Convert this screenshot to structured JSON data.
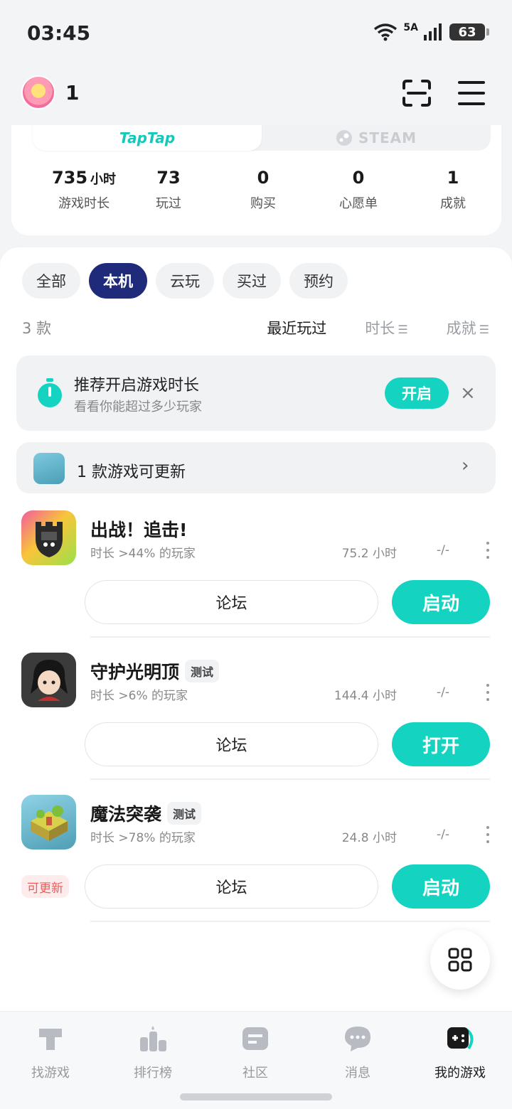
{
  "status_bar": {
    "time": "03:45",
    "network": "5A",
    "battery": "63"
  },
  "header": {
    "username": "1",
    "scan_icon": "scan-icon",
    "menu_icon": "menu-icon"
  },
  "platform_tabs": [
    {
      "label": "TapTap",
      "active": true
    },
    {
      "label": "STEAM",
      "active": false
    }
  ],
  "stats": [
    {
      "value": "735",
      "unit": "小时",
      "label": "游戏时长"
    },
    {
      "value": "73",
      "label": "玩过"
    },
    {
      "value": "0",
      "label": "购买"
    },
    {
      "value": "0",
      "label": "心愿单"
    },
    {
      "value": "1",
      "label": "成就"
    }
  ],
  "filters": [
    {
      "label": "全部",
      "active": false
    },
    {
      "label": "本机",
      "active": true
    },
    {
      "label": "云玩",
      "active": false
    },
    {
      "label": "买过",
      "active": false
    },
    {
      "label": "预约",
      "active": false
    }
  ],
  "list_header": {
    "count": "3 款",
    "sort_recent": "最近玩过",
    "sort_hours": "时长",
    "sort_achievements": "成就"
  },
  "recommend": {
    "title": "推荐开启游戏时长",
    "subtitle": "看看你能超过多少玩家",
    "button": "开启",
    "close": "×"
  },
  "update_banner": {
    "text": "1 款游戏可更新",
    "chevron": "›"
  },
  "games": [
    {
      "name": "出战！追击!",
      "tag": "",
      "subtitle": "时长 >44% 的玩家",
      "hours": "75.2 小时",
      "achievements": "-/-",
      "forum": "论坛",
      "action": "启动",
      "badge": ""
    },
    {
      "name": "守护光明顶",
      "tag": "测试",
      "subtitle": "时长 >6% 的玩家",
      "hours": "144.4 小时",
      "achievements": "-/-",
      "forum": "论坛",
      "action": "打开",
      "badge": ""
    },
    {
      "name": "魔法突袭",
      "tag": "测试",
      "subtitle": "时长 >78% 的玩家",
      "hours": "24.8 小时",
      "achievements": "-/-",
      "forum": "论坛",
      "action": "启动",
      "badge": "可更新"
    }
  ],
  "bottom_nav": [
    {
      "label": "找游戏",
      "icon": "find-games-icon",
      "active": false
    },
    {
      "label": "排行榜",
      "icon": "leaderboard-icon",
      "active": false
    },
    {
      "label": "社区",
      "icon": "community-icon",
      "active": false
    },
    {
      "label": "消息",
      "icon": "messages-icon",
      "active": false
    },
    {
      "label": "我的游戏",
      "icon": "my-games-icon",
      "active": true
    }
  ],
  "colors": {
    "accent": "#14d3c1",
    "chip_active": "#1f2a7a",
    "badge_red": "#f05b5b"
  }
}
